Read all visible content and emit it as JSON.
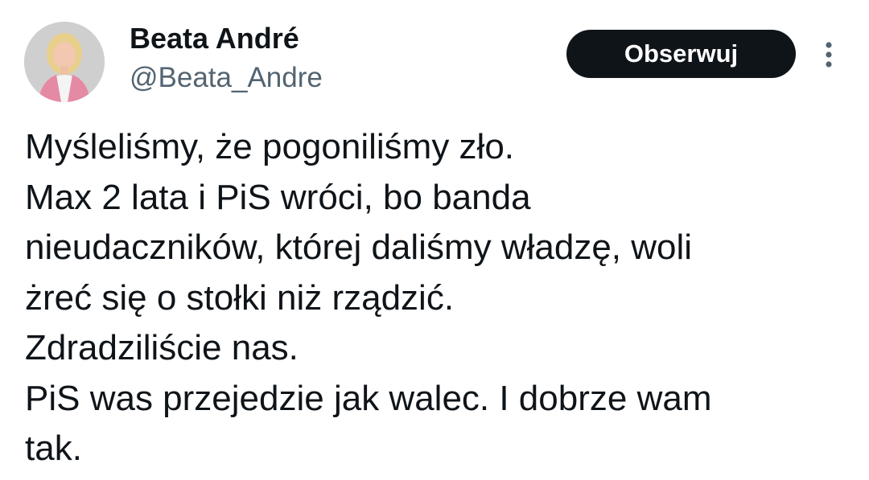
{
  "author": {
    "display_name": "Beata André",
    "handle": "@Beata_Andre",
    "avatar_icon": "profile-photo"
  },
  "actions": {
    "follow_label": "Obserwuj",
    "more_icon": "more-vertical-icon",
    "follow_bg": "#0f1419",
    "follow_fg": "#ffffff"
  },
  "tweet": {
    "lines": [
      "Myśleliśmy, że pogoniliśmy zło.",
      "Max 2 lata i PiS wróci, bo banda",
      "nieudaczników, której daliśmy władzę, woli",
      "żreć się o stołki niż rządzić.",
      "Zdradziliście nas.",
      "PiS was przejedzie jak walec. I dobrze wam",
      "tak."
    ]
  },
  "colors": {
    "text": "#0f1419",
    "secondary_text": "#536471",
    "background": "#ffffff"
  }
}
